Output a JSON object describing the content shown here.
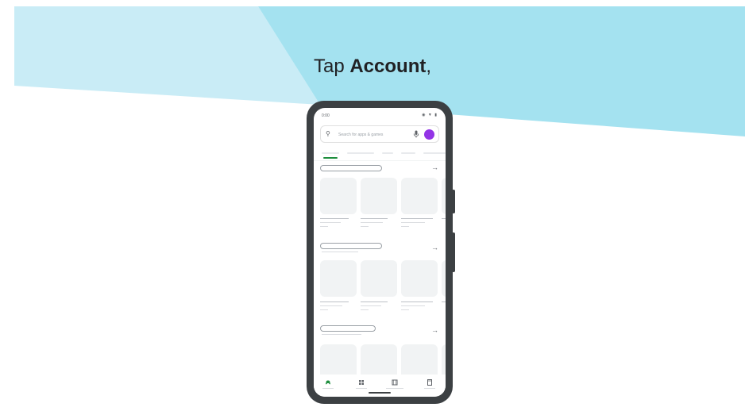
{
  "headline": {
    "prefix": "Tap ",
    "emphasis": "Account",
    "suffix": ","
  },
  "phone": {
    "status": {
      "time": "0:00",
      "icons": "◉ ▼ ▮"
    },
    "search": {
      "placeholder": "Search for apps & games",
      "icon": "search-icon",
      "mic_icon": "mic-icon"
    },
    "account_avatar_color": "#9334e6",
    "accent_color": "#1e8e3e",
    "sections": [
      {
        "arrow": "→"
      },
      {
        "arrow": "→"
      },
      {
        "arrow": "→"
      }
    ],
    "nav_icons": [
      "games-icon",
      "apps-icon",
      "movies-icon",
      "books-icon"
    ]
  },
  "colors": {
    "band_left": "#c9ecf6",
    "band_right": "#a4e2f0",
    "phone_frame": "#3c4043"
  }
}
